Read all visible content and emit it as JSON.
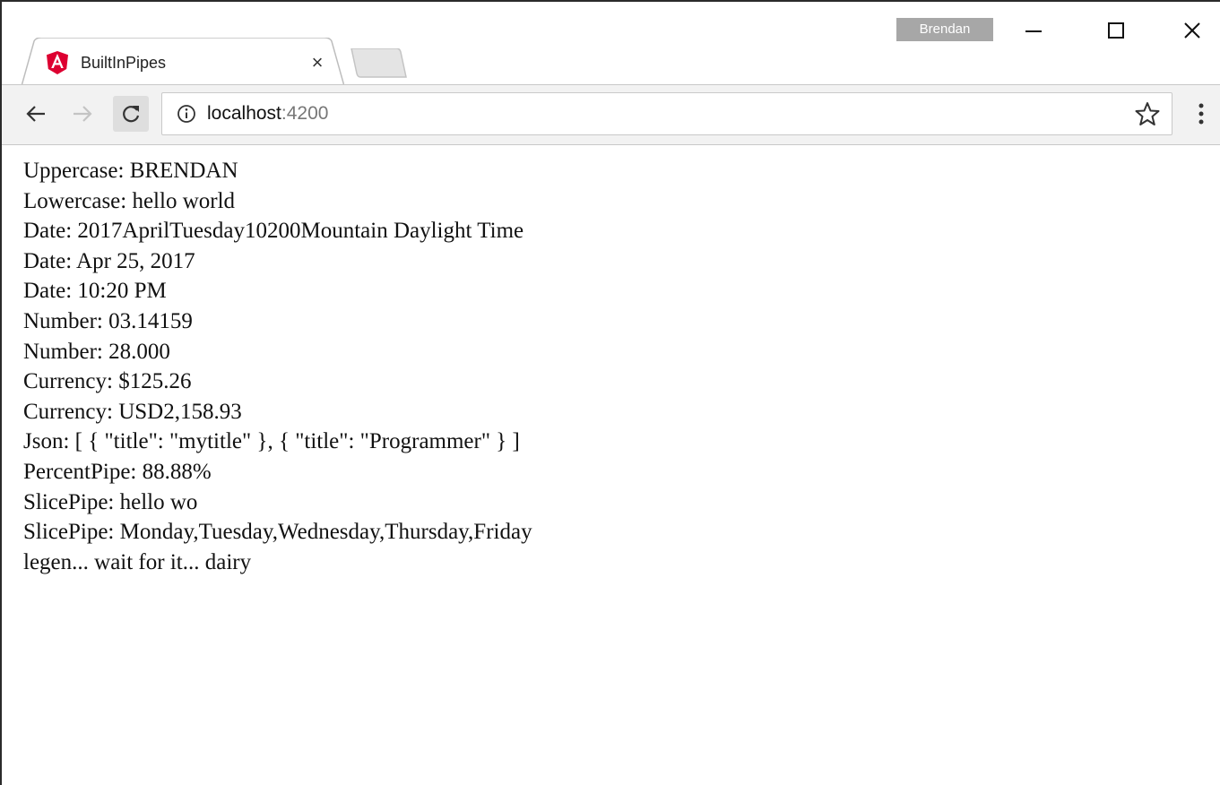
{
  "window": {
    "profile_name": "Brendan",
    "controls": {
      "minimize_icon": "minimize-icon",
      "maximize_icon": "maximize-icon",
      "close_icon": "close-icon"
    }
  },
  "tab": {
    "title": "BuiltInPipes",
    "favicon": "angular-logo-icon",
    "close_symbol": "×"
  },
  "toolbar": {
    "url_host": "localhost",
    "url_port": ":4200",
    "icons": [
      "back-arrow-icon",
      "forward-arrow-icon",
      "reload-icon",
      "info-icon",
      "star-icon",
      "kebab-menu-icon"
    ]
  },
  "colors": {
    "angular_red": "#dd0031",
    "toolbar_bg": "#f2f2f2",
    "profile_badge": "#a7a7a7"
  },
  "content": {
    "lines": [
      "Uppercase: BRENDAN",
      "Lowercase: hello world",
      "Date: 2017AprilTuesday10200Mountain Daylight Time",
      "Date: Apr 25, 2017",
      "Date: 10:20 PM",
      "Number: 03.14159",
      "Number: 28.000",
      "Currency: $125.26",
      "Currency: USD2,158.93",
      "Json: [ { \"title\": \"mytitle\" }, { \"title\": \"Programmer\" } ]",
      "PercentPipe: 88.88%",
      "SlicePipe: hello wo",
      "SlicePipe: Monday,Tuesday,Wednesday,Thursday,Friday",
      "legen... wait for it... dairy"
    ]
  }
}
